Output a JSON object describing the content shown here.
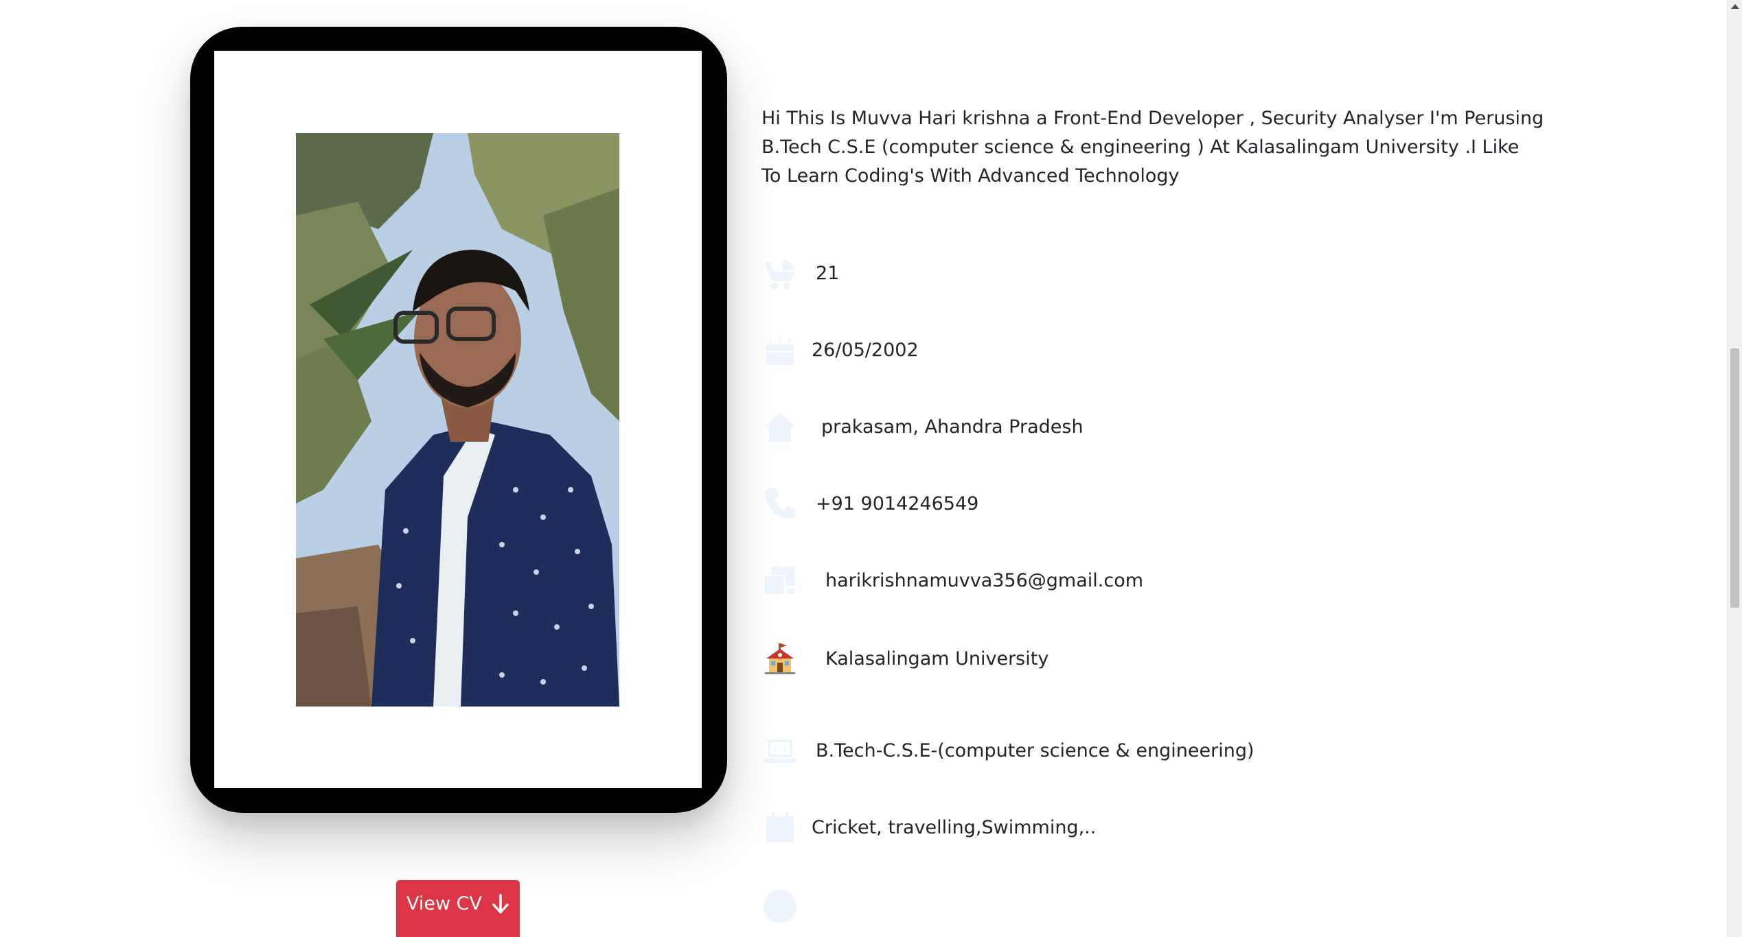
{
  "profile": {
    "bio": "Hi This Is Muvva Hari krishna a Front-End Developer , Security Analyser I'm Perusing B.Tech C.S.E (computer science & engineering ) At Kalasalingam University .I Like To Learn Coding's With Advanced Technology",
    "view_cv_label": "View CV"
  },
  "info": {
    "age": "21",
    "birthday": "26/05/2002",
    "location": "prakasam, Ahandra Pradesh",
    "phone": "+91 9014246549",
    "email": "harikrishnamuvva356@gmail.com",
    "university": "Kalasalingam University",
    "degree": "B.Tech-C.S.E-(computer science & engineering)",
    "hobbies": "Cricket, travelling,Swimming,.."
  },
  "icons": {
    "age": "baby-carriage-icon",
    "birthday": "birthday-cake-icon",
    "location": "home-icon",
    "phone": "phone-icon",
    "email": "mail-bulk-icon",
    "university": "school-emoji-icon",
    "degree": "laptop-code-icon",
    "hobbies": "calendar-icon",
    "website": "globe-icon"
  },
  "colors": {
    "button": "#dc3545",
    "text": "#212529",
    "icon_faint": "#eef4fb",
    "phone_frame": "#000000"
  }
}
